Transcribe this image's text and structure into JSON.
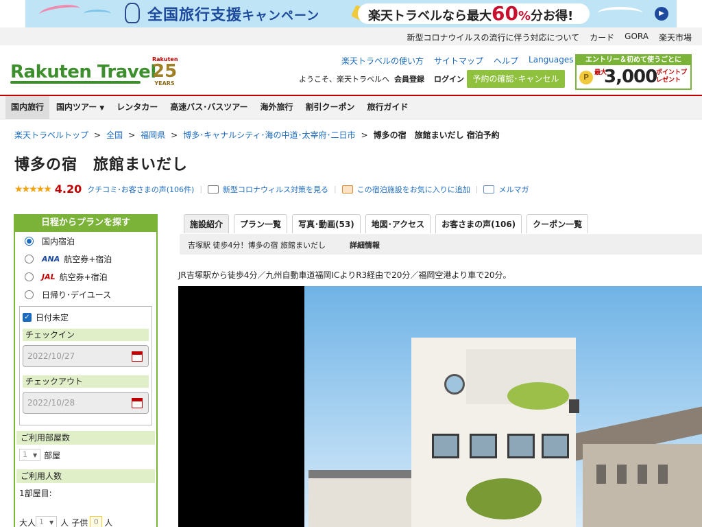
{
  "banner": {
    "title": "全国旅行支援",
    "campaign": "キャンペーン",
    "pill_prefix": "楽天トラベルなら最大",
    "pill_number": "60",
    "pill_pct": "%",
    "pill_suffix": "分お得!"
  },
  "toplinks": [
    "新型コロナウイルスの流行に伴う対応について",
    "カード",
    "GORA",
    "楽天市場"
  ],
  "header": {
    "logo": "Rakuten Travel",
    "anniv_brand": "Rakuten",
    "anniv_num": "25",
    "anniv_word": "YEARS",
    "nav": [
      "楽天トラベルの使い方",
      "サイトマップ",
      "ヘルプ",
      "Languages"
    ],
    "welcome": "ようこそ、楽天トラベルへ",
    "member": "会員登録",
    "login": "ログイン",
    "reserve": "予約の確認･キャンセル",
    "promo_top": "エントリー＆初めて使うごとに",
    "promo_small": "最大",
    "promo_amount": "3,000",
    "promo_pts": "ポイントプレゼント",
    "promo_coin": "P"
  },
  "mainnav": [
    "国内旅行",
    "国内ツアー",
    "レンタカー",
    "高速バス･バスツアー",
    "海外旅行",
    "割引クーポン",
    "旅行ガイド"
  ],
  "breadcrumb": [
    "楽天トラベルトップ",
    "全国",
    "福岡県",
    "博多･キャナルシティ･海の中道･太宰府･二日市"
  ],
  "breadcrumb_sep": ">",
  "breadcrumb_current": "博多の宿　旅館まいだし 宿泊予約",
  "hotel": {
    "title": "博多の宿　旅館まいだし",
    "stars": "★★★★★",
    "rating": 4.2,
    "score": "4.20",
    "review_link": "クチコミ･お客さまの声(106件)",
    "covid_link": "新型コロナウィルス対策を見る",
    "fav_link": "この宿泊施設をお気に入りに追加",
    "mail_link": "メルマガ"
  },
  "sidebar": {
    "title": "日程からプランを探す",
    "options": [
      "国内宿泊",
      "航空券+宿泊",
      "航空券+宿泊",
      "日帰り･デイユース"
    ],
    "ana": "ANA",
    "jal": "JAL",
    "undecided": "日付未定",
    "checkin_label": "チェックイン",
    "checkin_value": "2022/10/27",
    "checkout_label": "チェックアウト",
    "checkout_value": "2022/10/28",
    "rooms_label": "ご利用部屋数",
    "rooms_value": "1",
    "rooms_unit": "部屋",
    "guests_label": "ご利用人数",
    "room1": "1部屋目:",
    "adult": "大人",
    "adult_value": "1",
    "adult_unit": "人",
    "child": "子供",
    "child_value": "0",
    "child_unit": "人"
  },
  "tabs": [
    {
      "label": "施設紹介"
    },
    {
      "label": "プラン一覧"
    },
    {
      "label": "写真･動画",
      "count": "(53)"
    },
    {
      "label": "地図･アクセス"
    },
    {
      "label": "お客さまの声",
      "count": "(106)"
    },
    {
      "label": "クーポン一覧"
    }
  ],
  "subtabs": [
    "吉塚駅 徒歩4分！博多の宿 旅館まいだし",
    "詳細情報"
  ],
  "access": "JR吉塚駅から徒歩4分／九州自動車道福岡ICよりR3経由で20分／福岡空港より車で20分。",
  "colors": {
    "brand_green": "#3d8f2d",
    "accent_green": "#7bb339",
    "rakuten_red": "#bf0000",
    "link_blue": "#1d6bbf"
  }
}
